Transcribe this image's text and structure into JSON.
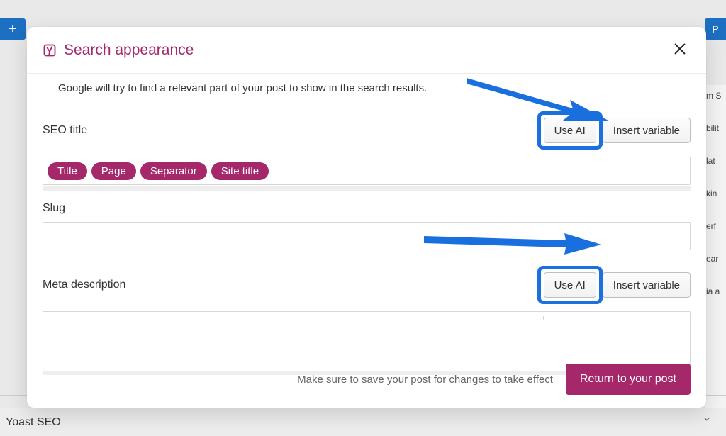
{
  "background": {
    "add_plus": "+",
    "sidebar_frags": [
      "m S",
      "bilit",
      "lat",
      "kin",
      "erf",
      "ear",
      "ia a"
    ],
    "bottom_left": "Yoast SEO",
    "publish_frag": "P"
  },
  "modal": {
    "title": "Search appearance",
    "intro_line": "Google will try to find a relevant part of your post to show in the search results.",
    "seo_title": {
      "label": "SEO title",
      "use_ai": "Use AI",
      "insert_variable": "Insert variable",
      "pills": [
        "Title",
        "Page",
        "Separator",
        "Site title"
      ]
    },
    "slug": {
      "label": "Slug",
      "value": ""
    },
    "meta": {
      "label": "Meta description",
      "use_ai": "Use AI",
      "insert_variable": "Insert variable",
      "value": ""
    },
    "footer_message": "Make sure to save your post for changes to take effect",
    "return_btn": "Return to your post"
  }
}
